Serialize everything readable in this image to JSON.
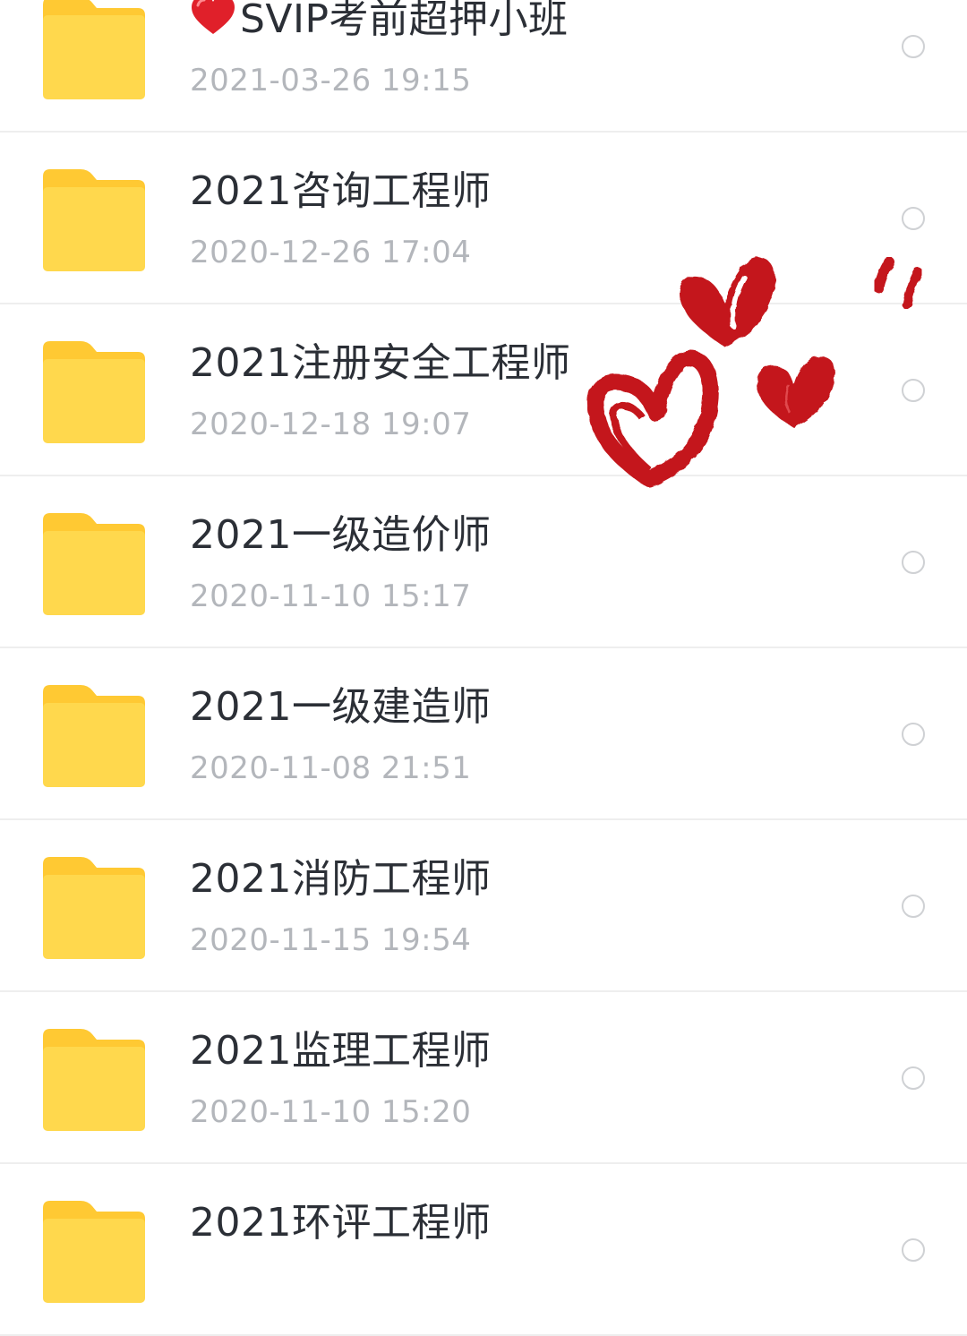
{
  "files": [
    {
      "name": "SVIP考前超押小班",
      "prefix_icon": "red-heart-emoji",
      "time": "2021-03-26  19:15"
    },
    {
      "name": "2021咨询工程师",
      "time": "2020-12-26  17:04"
    },
    {
      "name": "2021注册安全工程师",
      "time": "2020-12-18  19:07"
    },
    {
      "name": "2021一级造价师",
      "time": "2020-11-10  15:17"
    },
    {
      "name": "2021一级建造师",
      "time": "2020-11-08  21:51"
    },
    {
      "name": "2021消防工程师",
      "time": "2020-11-15  19:54"
    },
    {
      "name": "2021监理工程师",
      "time": "2020-11-10  15:20"
    },
    {
      "name": "2021环评工程师",
      "time": ""
    }
  ],
  "icons": {
    "folder": "folder-icon",
    "select": "radio-circle-icon",
    "decoration": "hand-drawn-red-hearts"
  },
  "colors": {
    "folder_fill": "#FFD84D",
    "folder_tab": "#FFC933",
    "title_text": "#2B2F36",
    "time_text": "#B3B6BB",
    "divider": "#EEEEEE",
    "heart_red": "#C4161C"
  }
}
